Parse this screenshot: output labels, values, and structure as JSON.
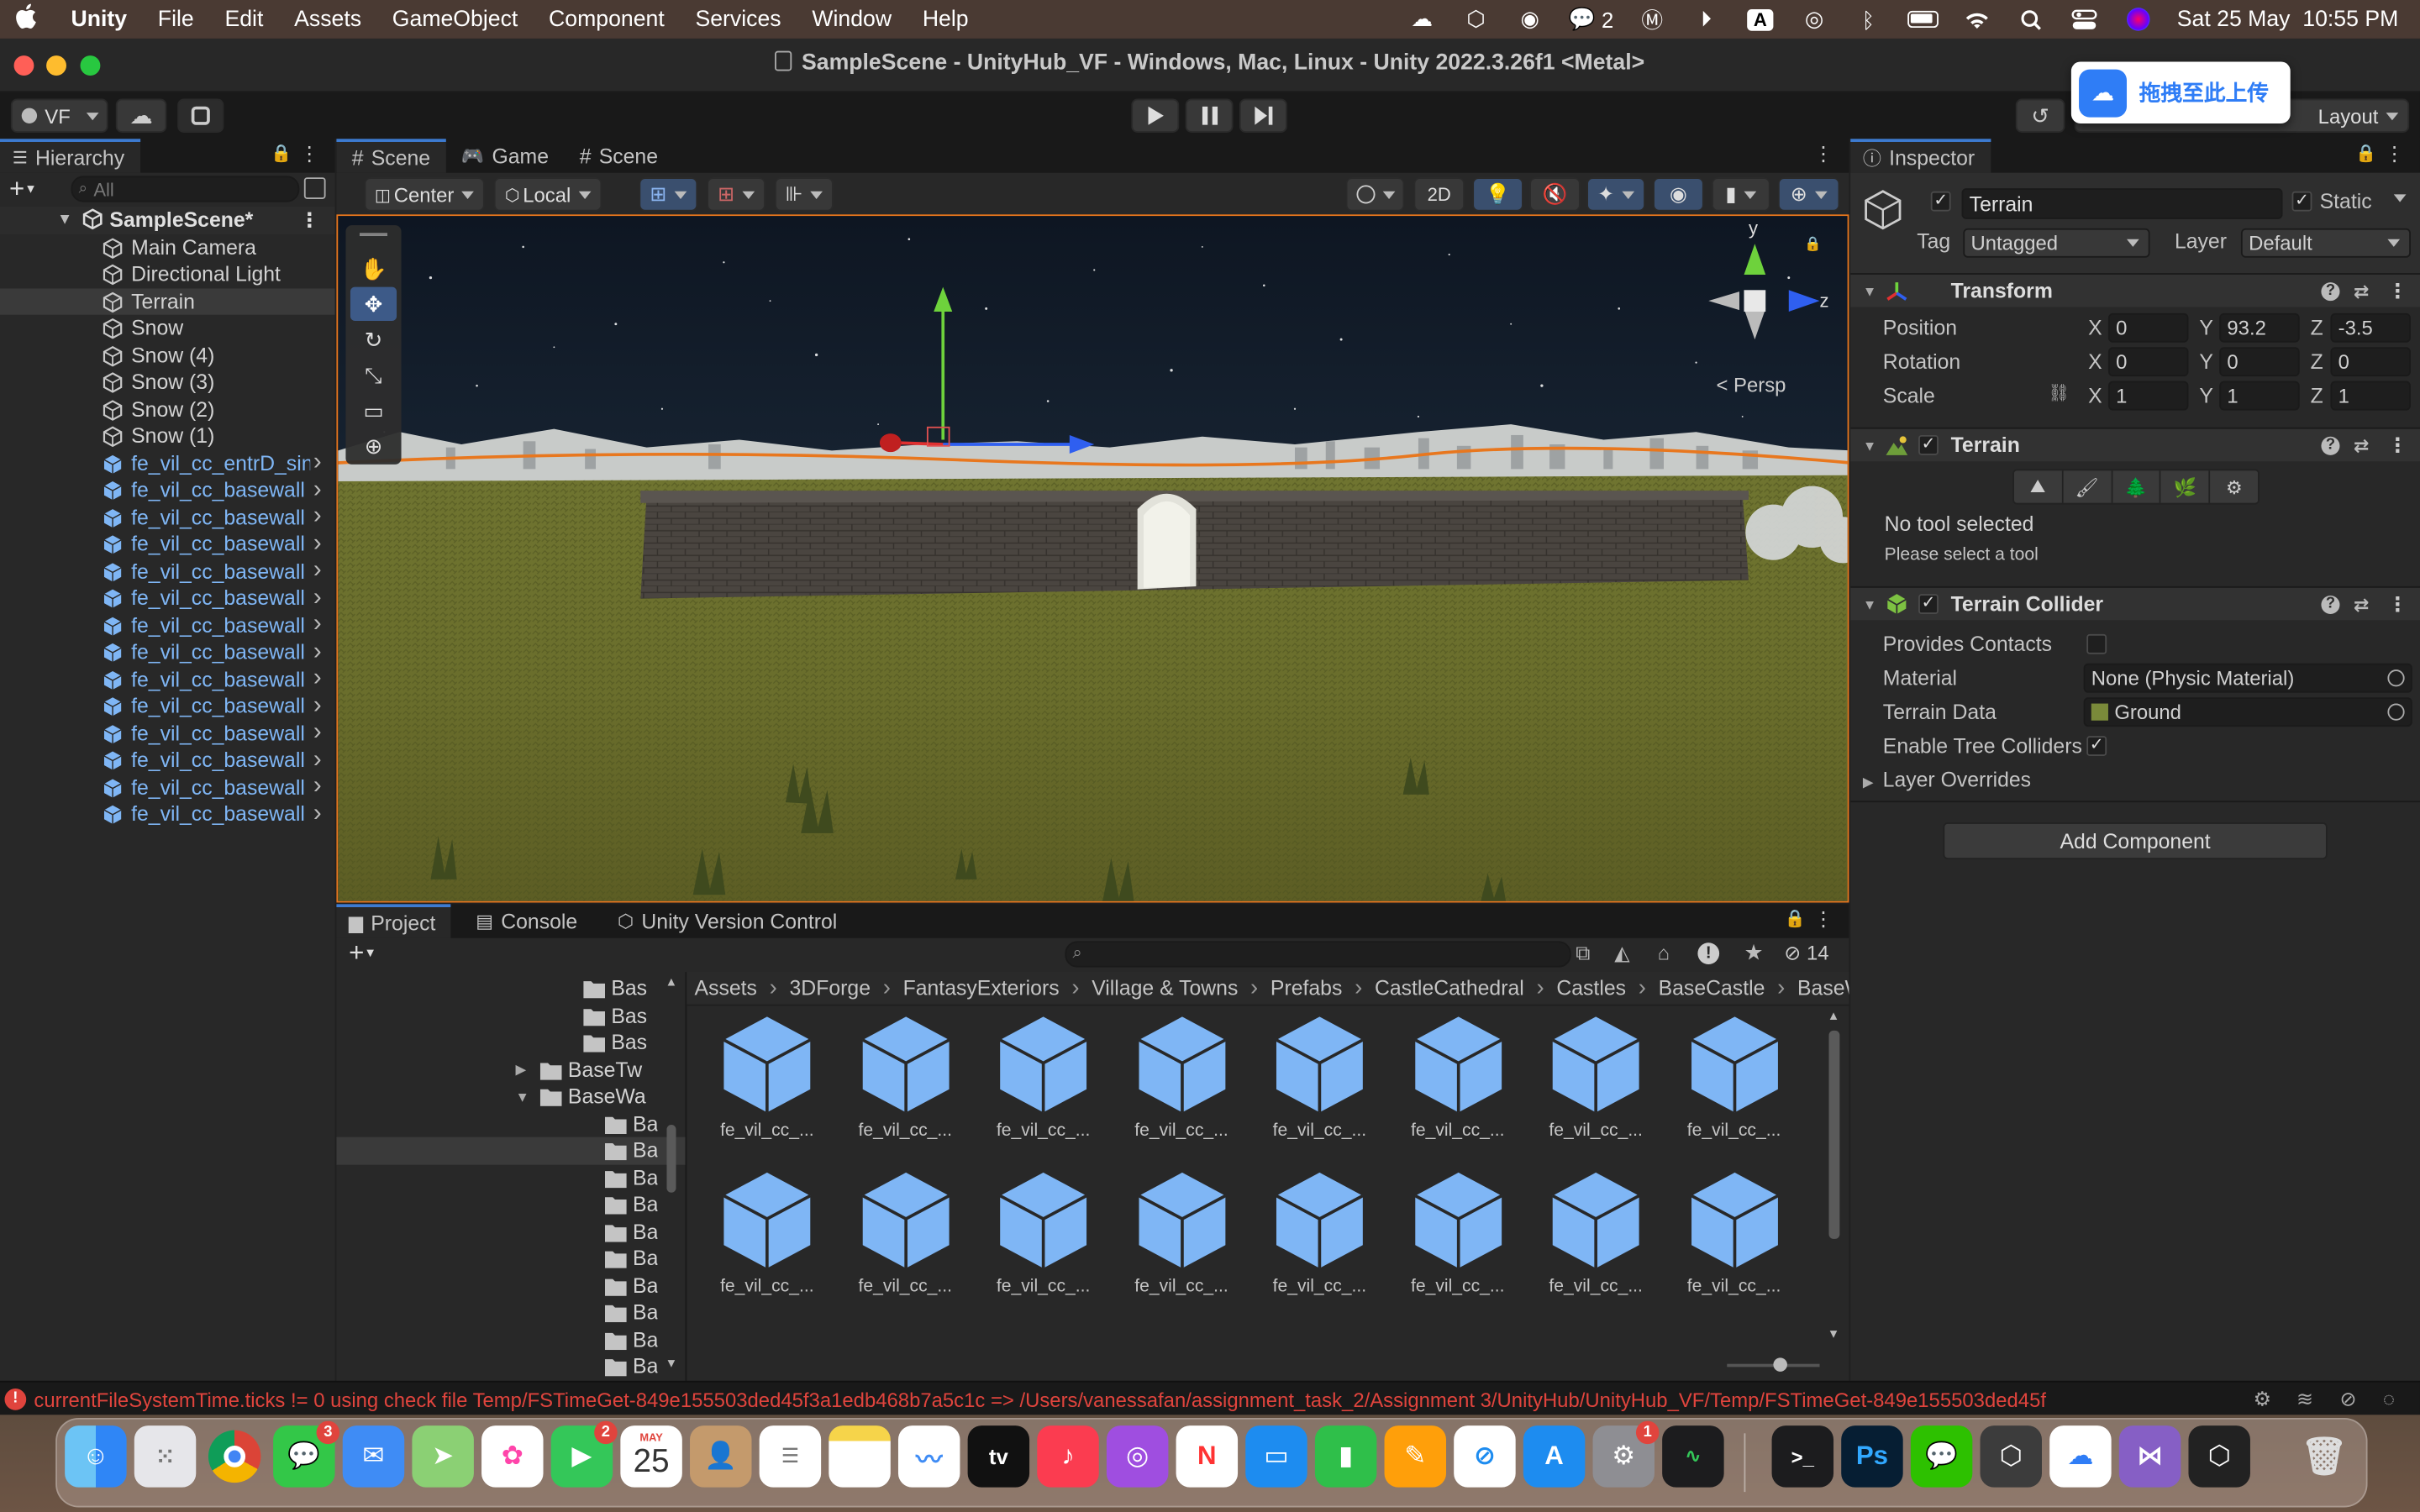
{
  "menubar": {
    "app": "Unity",
    "items": [
      "File",
      "Edit",
      "Assets",
      "GameObject",
      "Component",
      "Services",
      "Window",
      "Help"
    ],
    "wechat_count": "2",
    "input_badge": "A",
    "clock": "Sat 25 May  10:55 PM"
  },
  "window": {
    "title": "SampleScene - UnityHub_VF - Windows, Mac, Linux - Unity 2022.3.26f1 <Metal>"
  },
  "toolbar": {
    "account": "VF",
    "layout": "Layout",
    "upload_popup": "拖拽至此上传"
  },
  "hierarchy": {
    "tab": "Hierarchy",
    "search_placeholder": "All",
    "scene": "SampleScene*",
    "items": [
      {
        "label": "Main Camera",
        "type": "object"
      },
      {
        "label": "Directional Light",
        "type": "object"
      },
      {
        "label": "Terrain",
        "type": "object",
        "selected": true
      },
      {
        "label": "Snow",
        "type": "object"
      },
      {
        "label": "Snow (4)",
        "type": "object"
      },
      {
        "label": "Snow (3)",
        "type": "object"
      },
      {
        "label": "Snow (2)",
        "type": "object"
      },
      {
        "label": "Snow (1)",
        "type": "object"
      },
      {
        "label": "fe_vil_cc_entrD_sin",
        "type": "prefab"
      },
      {
        "label": "fe_vil_cc_basewall",
        "type": "prefab"
      },
      {
        "label": "fe_vil_cc_basewall",
        "type": "prefab"
      },
      {
        "label": "fe_vil_cc_basewall",
        "type": "prefab"
      },
      {
        "label": "fe_vil_cc_basewall",
        "type": "prefab"
      },
      {
        "label": "fe_vil_cc_basewall",
        "type": "prefab"
      },
      {
        "label": "fe_vil_cc_basewall",
        "type": "prefab"
      },
      {
        "label": "fe_vil_cc_basewall",
        "type": "prefab"
      },
      {
        "label": "fe_vil_cc_basewall",
        "type": "prefab"
      },
      {
        "label": "fe_vil_cc_basewall",
        "type": "prefab"
      },
      {
        "label": "fe_vil_cc_basewall",
        "type": "prefab"
      },
      {
        "label": "fe_vil_cc_basewall",
        "type": "prefab"
      },
      {
        "label": "fe_vil_cc_basewall",
        "type": "prefab"
      },
      {
        "label": "fe_vil_cc_basewall",
        "type": "prefab"
      }
    ]
  },
  "scene_view": {
    "tabs": [
      "Scene",
      "Game",
      "Scene"
    ],
    "pivot_mode": "Center",
    "pivot_space": "Local",
    "mode_2d": "2D",
    "gizmo_y": "y",
    "gizmo_z": "z",
    "projection": "Persp"
  },
  "inspector": {
    "tab": "Inspector",
    "object_name": "Terrain",
    "static_label": "Static",
    "tag_label": "Tag",
    "tag_value": "Untagged",
    "layer_label": "Layer",
    "layer_value": "Default",
    "transform": {
      "title": "Transform",
      "position": {
        "label": "Position",
        "x": "0",
        "y": "93.2",
        "z": "-3.5"
      },
      "rotation": {
        "label": "Rotation",
        "x": "0",
        "y": "0",
        "z": "0"
      },
      "scale": {
        "label": "Scale",
        "x": "1",
        "y": "1",
        "z": "1"
      }
    },
    "terrain": {
      "title": "Terrain",
      "status": "No tool selected",
      "hint": "Please select a tool"
    },
    "collider": {
      "title": "Terrain Collider",
      "provides_contacts": "Provides Contacts",
      "material_label": "Material",
      "material_value": "None (Physic Material)",
      "data_label": "Terrain Data",
      "data_value": "Ground",
      "trees_label": "Enable Tree Colliders",
      "overrides": "Layer Overrides"
    },
    "add_component": "Add Component"
  },
  "project": {
    "tabs": [
      "Project",
      "Console",
      "Unity Version Control"
    ],
    "hidden_count": "14",
    "tree": [
      {
        "label": "Bas",
        "indent": 0,
        "arrow": ""
      },
      {
        "label": "Bas",
        "indent": 0,
        "arrow": ""
      },
      {
        "label": "Bas",
        "indent": 0,
        "arrow": ""
      },
      {
        "label": "BaseTw",
        "indent": -2,
        "arrow": "▶"
      },
      {
        "label": "BaseWa",
        "indent": -2,
        "arrow": "▼",
        "open": true
      },
      {
        "label": "BaseV",
        "indent": 1,
        "arrow": ""
      },
      {
        "label": "BaseV",
        "indent": 1,
        "arrow": "",
        "selected": true
      },
      {
        "label": "BaseV",
        "indent": 1,
        "arrow": ""
      },
      {
        "label": "BaseV",
        "indent": 1,
        "arrow": ""
      },
      {
        "label": "BaseV",
        "indent": 1,
        "arrow": ""
      },
      {
        "label": "BaseV",
        "indent": 1,
        "arrow": ""
      },
      {
        "label": "BaseV",
        "indent": 1,
        "arrow": ""
      },
      {
        "label": "BaseV",
        "indent": 1,
        "arrow": ""
      },
      {
        "label": "BaseV",
        "indent": 1,
        "arrow": ""
      },
      {
        "label": "BaseV",
        "indent": 1,
        "arrow": ""
      }
    ],
    "breadcrumb": [
      "Assets",
      "3DForge",
      "FantasyExteriors",
      "Village & Towns",
      "Prefabs",
      "CastleCathedral",
      "Castles",
      "BaseCastle",
      "BaseW"
    ],
    "assets": [
      "fe_vil_cc_...",
      "fe_vil_cc_...",
      "fe_vil_cc_...",
      "fe_vil_cc_...",
      "fe_vil_cc_...",
      "fe_vil_cc_...",
      "fe_vil_cc_...",
      "fe_vil_cc_...",
      "fe_vil_cc_...",
      "fe_vil_cc_...",
      "fe_vil_cc_...",
      "fe_vil_cc_...",
      "fe_vil_cc_...",
      "fe_vil_cc_...",
      "fe_vil_cc_...",
      "fe_vil_cc_..."
    ]
  },
  "status_bar": {
    "message": "currentFileSystemTime.ticks != 0 using check file Temp/FSTimeGet-849e155503ded45f3a1edb468b7a5c1c => /Users/vanessafan/assignment_task_2/Assignment 3/UnityHub/UnityHub_VF/Temp/FSTimeGet-849e155503ded45f"
  },
  "dock": {
    "messages_badge": "3",
    "facetime_badge": "2",
    "calendar_month": "MAY",
    "calendar_day": "25",
    "settings_badge": "1",
    "appletv": "tv",
    "photoshop": "Ps"
  },
  "colors": {
    "accent": "#3d7bd1",
    "prefab": "#7fb6f5",
    "error": "#e0443d",
    "scene_border": "#e8771e"
  }
}
